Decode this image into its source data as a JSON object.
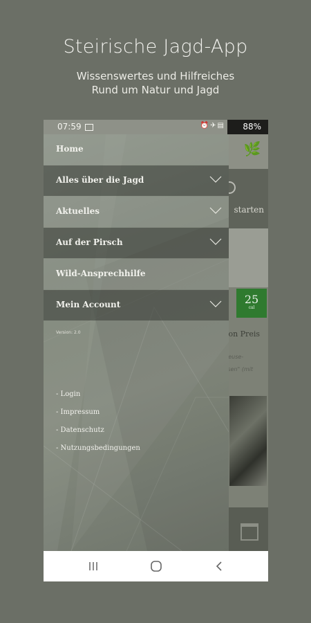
{
  "promo": {
    "title": "Steirische Jagd-App",
    "subtitle_line1": "Wissenswertes und Hilfreiches",
    "subtitle_line2": "Rund um Natur und Jagd"
  },
  "status_bar": {
    "time": "07:59",
    "battery": "88%"
  },
  "drawer": {
    "items": [
      {
        "label": "Home",
        "expandable": false
      },
      {
        "label": "Alles über die Jagd",
        "expandable": true
      },
      {
        "label": "Aktuelles",
        "expandable": true
      },
      {
        "label": "Auf der Pirsch",
        "expandable": true
      },
      {
        "label": "Wild-Ansprechhilfe",
        "expandable": false
      },
      {
        "label": "Mein Account",
        "expandable": true
      }
    ],
    "version": "Version: 2.0",
    "links": [
      "- Login",
      "- Impressum",
      "- Datenschutz",
      "- Nutzungsbedingungen"
    ]
  },
  "background_app": {
    "start_text": "starten",
    "badge_number": "25",
    "badge_sub": "cal",
    "preis_text": "lon Preis",
    "line1": "heuse-",
    "line2": "ssen\" (mit"
  },
  "colors": {
    "backdrop": "#6b6f66",
    "badge": "#2f7a2f"
  }
}
